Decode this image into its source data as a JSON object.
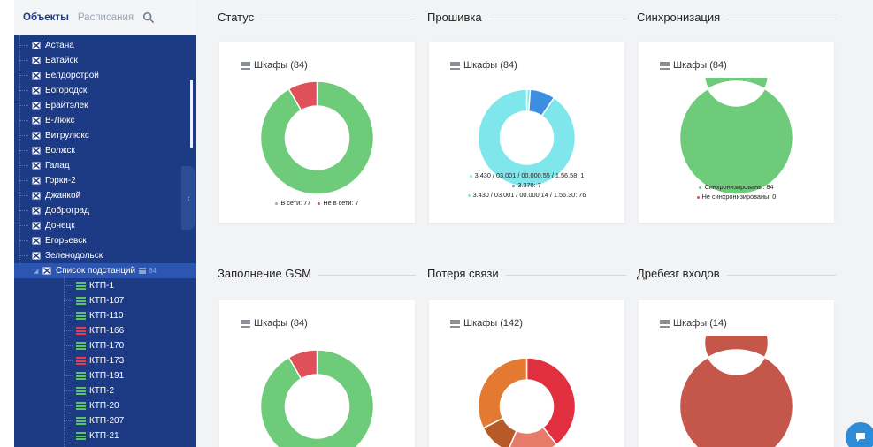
{
  "sidebar": {
    "tabs": [
      "Объекты",
      "Расписания"
    ],
    "tree": [
      {
        "label": "Астана"
      },
      {
        "label": "Батайск"
      },
      {
        "label": "Белдорстрой"
      },
      {
        "label": "Богородск"
      },
      {
        "label": "Брайтэлек"
      },
      {
        "label": "В-Люкс"
      },
      {
        "label": "Витрулюкс"
      },
      {
        "label": "Волжск"
      },
      {
        "label": "Галад"
      },
      {
        "label": "Горки-2"
      },
      {
        "label": "Джанкой"
      },
      {
        "label": "Доброград"
      },
      {
        "label": "Донецк"
      },
      {
        "label": "Егорьевск"
      },
      {
        "label": "Зеленодольск"
      }
    ],
    "group": {
      "label": "Список подстанций",
      "count": "84"
    },
    "items": [
      {
        "label": "КТП-1",
        "status": "ok"
      },
      {
        "label": "КТП-107",
        "status": "ok"
      },
      {
        "label": "КТП-110",
        "status": "ok"
      },
      {
        "label": "КТП-166",
        "status": "error"
      },
      {
        "label": "КТП-170",
        "status": "ok"
      },
      {
        "label": "КТП-173",
        "status": "error"
      },
      {
        "label": "КТП-191",
        "status": "ok"
      },
      {
        "label": "КТП-2",
        "status": "ok"
      },
      {
        "label": "КТП-20",
        "status": "ok"
      },
      {
        "label": "КТП-207",
        "status": "ok"
      },
      {
        "label": "КТП-21",
        "status": "ok"
      }
    ]
  },
  "colors": {
    "ok": "#5bc46a",
    "error": "#e0404a",
    "green": "#6dcb7a",
    "red": "#e0505a",
    "cyan": "#7fe6ec",
    "blue": "#3c8fe0"
  },
  "sections": [
    {
      "title": "Статус",
      "card": "Шкафы (84)"
    },
    {
      "title": "Прошивка",
      "card": "Шкафы (84)"
    },
    {
      "title": "Синхронизация",
      "card": "Шкафы (84)"
    },
    {
      "title": "Заполнение GSM",
      "card": "Шкафы (84)"
    },
    {
      "title": "Потеря связи",
      "card": "Шкафы (142)"
    },
    {
      "title": "Дребезг входов",
      "card": "Шкафы (14)"
    }
  ],
  "legends": {
    "status": [
      {
        "text": "В сети: 77",
        "color": "#6dcb7a"
      },
      {
        "text": "Не в сети: 7",
        "color": "#e0505a"
      }
    ],
    "firmware": [
      {
        "text": "3.430 / 03.001 / 00.000.55 / 1.56.58: 1",
        "color": "#7fe6ec"
      },
      {
        "text": "3.370: 7",
        "color": "#3c8fe0"
      },
      {
        "text": "3.430 / 03.001 / 00.000.14 / 1.56.30: 76",
        "color": "#7fe6ec"
      }
    ],
    "sync": [
      {
        "text": "Синхронизированы: 84",
        "color": "#6dcb7a"
      },
      {
        "text": "Не синхронизированы: 0",
        "color": "#e0505a"
      }
    ]
  },
  "chart_data": [
    {
      "type": "pie",
      "title": "Статус",
      "categories": [
        "В сети",
        "Не в сети"
      ],
      "values": [
        77,
        7
      ],
      "colors": [
        "#6dcb7a",
        "#e0505a"
      ]
    },
    {
      "type": "pie",
      "title": "Прошивка",
      "categories": [
        "3.430 / 03.001 / 00.000.55 / 1.56.58",
        "3.370",
        "3.430 / 03.001 / 00.000.14 / 1.56.30"
      ],
      "values": [
        1,
        7,
        76
      ],
      "colors": [
        "#7fe6ec",
        "#3c8fe0",
        "#7fe6ec"
      ]
    },
    {
      "type": "pie",
      "title": "Синхронизация",
      "categories": [
        "Синхронизированы",
        "Не синхронизированы"
      ],
      "values": [
        84,
        0
      ],
      "colors": [
        "#6dcb7a",
        "#e0505a"
      ]
    },
    {
      "type": "pie",
      "title": "Заполнение GSM",
      "values": [
        77,
        7
      ],
      "colors": [
        "#6dcb7a",
        "#e0505a"
      ]
    },
    {
      "type": "pie",
      "title": "Потеря связи",
      "values": [
        56,
        24,
        16,
        46
      ],
      "colors": [
        "#e0303f",
        "#e87a6a",
        "#b85a28",
        "#e47a32"
      ]
    },
    {
      "type": "pie",
      "title": "Дребезг входов",
      "values": [
        14
      ],
      "colors": [
        "#c4564a"
      ]
    }
  ]
}
